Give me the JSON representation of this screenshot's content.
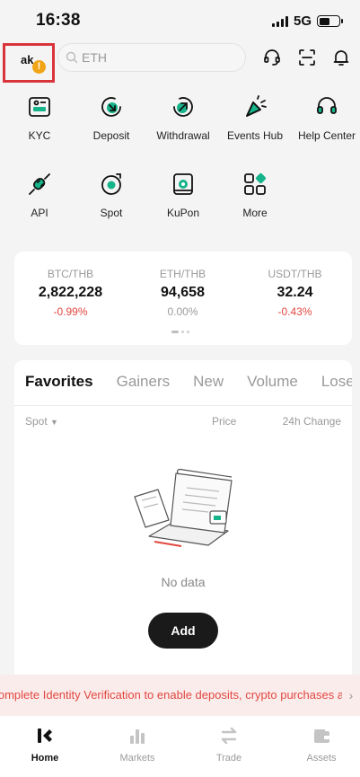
{
  "status_bar": {
    "time": "16:38",
    "network": "5G"
  },
  "header": {
    "avatar_text": "ak",
    "warning_badge": "!",
    "search_placeholder": "ETH",
    "icons": [
      "support-icon",
      "scan-icon",
      "bell-icon"
    ]
  },
  "shortcuts": [
    {
      "label": "KYC",
      "icon": "id-card-icon"
    },
    {
      "label": "Deposit",
      "icon": "deposit-icon"
    },
    {
      "label": "Withdrawal",
      "icon": "withdrawal-icon"
    },
    {
      "label": "Events Hub",
      "icon": "megaphone-icon"
    },
    {
      "label": "Help Center",
      "icon": "headset-icon"
    },
    {
      "label": "API",
      "icon": "plug-icon"
    },
    {
      "label": "Spot",
      "icon": "spot-icon"
    },
    {
      "label": "KuPon",
      "icon": "coupon-icon"
    },
    {
      "label": "More",
      "icon": "more-grid-icon"
    }
  ],
  "tickers": [
    {
      "pair": "BTC/THB",
      "price": "2,822,228",
      "change": "-0.99%",
      "direction": "down"
    },
    {
      "pair": "ETH/THB",
      "price": "94,658",
      "change": "0.00%",
      "direction": "flat"
    },
    {
      "pair": "USDT/THB",
      "price": "32.24",
      "change": "-0.43%",
      "direction": "down"
    }
  ],
  "market": {
    "tabs": [
      "Favorites",
      "Gainers",
      "New",
      "Volume",
      "Losers"
    ],
    "active_tab": "Favorites",
    "columns": {
      "spot": "Spot",
      "price": "Price",
      "change": "24h Change"
    },
    "empty_text": "No data",
    "add_label": "Add"
  },
  "banner": {
    "text": "Please complete Identity Verification to enable deposits, crypto purchases and trading."
  },
  "bottom_nav": [
    {
      "label": "Home",
      "icon": "home-icon",
      "active": true
    },
    {
      "label": "Markets",
      "icon": "markets-icon",
      "active": false
    },
    {
      "label": "Trade",
      "icon": "trade-icon",
      "active": false
    },
    {
      "label": "Assets",
      "icon": "wallet-icon",
      "active": false
    }
  ],
  "colors": {
    "accent": "#16b48a",
    "negative": "#e0473f",
    "warning": "#f2a417",
    "highlight": "#d9343a"
  }
}
